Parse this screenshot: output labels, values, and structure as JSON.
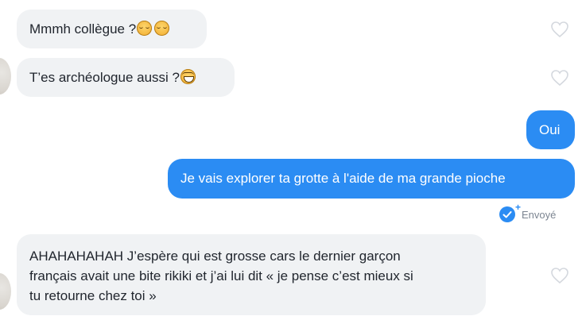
{
  "messages": [
    {
      "text": "Mmmh collègue ?",
      "emoji": [
        "sleepy-face-icon",
        "sleepy-face-icon"
      ]
    },
    {
      "text": "T’es archéologue aussi ?",
      "emoji": [
        "laughing-face-icon"
      ]
    },
    {
      "text": "Oui"
    },
    {
      "text": "Je vais explorer ta grotte à l'aide de ma grande pioche"
    },
    {
      "lines": [
        "AHAHAHAHAH J’espère qui est grosse cars le dernier garçon",
        "français avait une bite rikiki et j’ai lui dit « je pense c’est mieux si",
        "tu retourne chez toi »"
      ]
    }
  ],
  "status": {
    "label": "Envoyé",
    "icon": "sent-check-icon"
  },
  "colors": {
    "outgoing": "#2b8cf3",
    "incoming": "#f0f2f4",
    "heart": "#d4d8de"
  }
}
